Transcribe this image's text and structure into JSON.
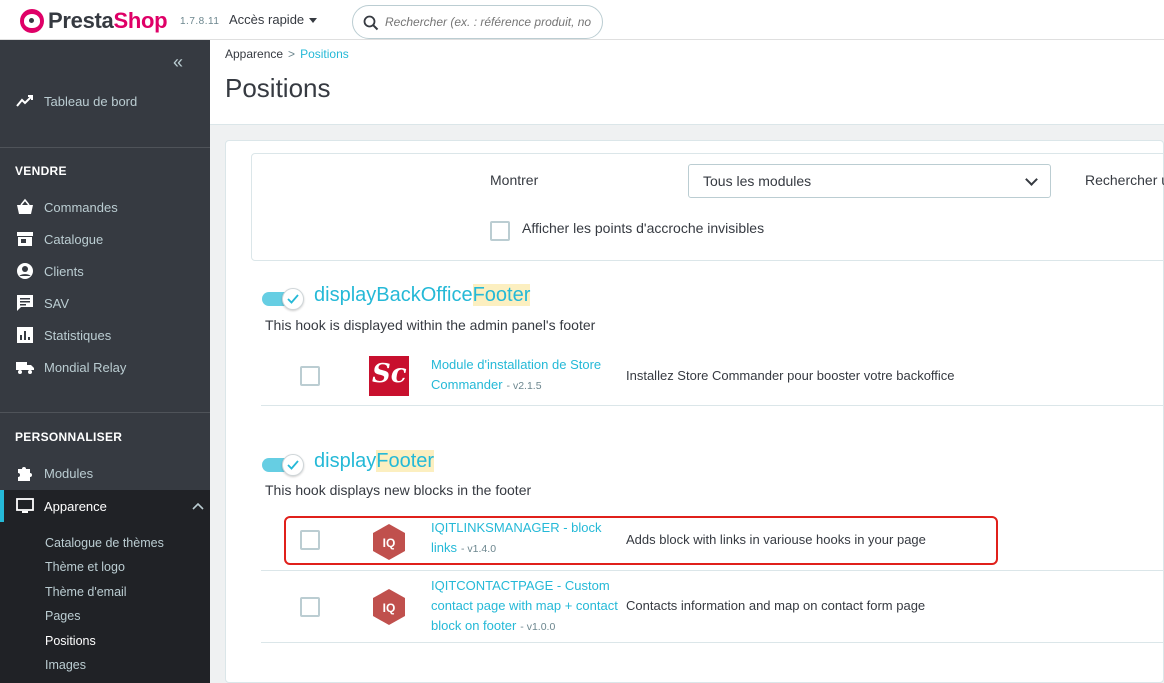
{
  "header": {
    "logo_prefix": "Presta",
    "logo_suffix": "Shop",
    "version": "1.7.8.11",
    "quick_access": "Accès rapide",
    "search_placeholder": "Rechercher (ex. : référence produit, no"
  },
  "sidebar": {
    "dashboard": "Tableau de bord",
    "section_sell": "VENDRE",
    "sell_items": [
      "Commandes",
      "Catalogue",
      "Clients",
      "SAV",
      "Statistiques",
      "Mondial Relay"
    ],
    "section_customize": "PERSONNALISER",
    "modules": "Modules",
    "appearance": "Apparence",
    "appearance_sub": [
      "Catalogue de thèmes",
      "Thème et logo",
      "Thème d'email",
      "Pages",
      "Positions",
      "Images"
    ]
  },
  "breadcrumb": {
    "parent": "Apparence",
    "separator": ">",
    "current": "Positions"
  },
  "page_title": "Positions",
  "filters": {
    "show_label": "Montrer",
    "show_value": "Tous les modules",
    "search_label": "Rechercher u",
    "invisible_hooks_label": "Afficher les points d'accroche invisibles"
  },
  "hooks": [
    {
      "name_prefix": "displayBackOffice",
      "name_highlight": "Footer",
      "description": "This hook is displayed within the admin panel's footer",
      "modules": [
        {
          "logo": "Sc",
          "name": "Module d'installation de Store Commander",
          "version": "- v2.1.5",
          "description": "Installez Store Commander pour booster votre backoffice"
        }
      ]
    },
    {
      "name_prefix": "display",
      "name_highlight": "Footer",
      "description": "This hook displays new blocks in the footer",
      "modules": [
        {
          "logo": "IQ",
          "name": "IQITLINKSMANAGER - block links",
          "version": "- v1.4.0",
          "description": "Adds block with links in variouse hooks in your page"
        },
        {
          "logo": "IQ",
          "name": "IQITCONTACTPAGE - Custom contact page with map + contact block on footer",
          "version": "- v1.0.0",
          "description": "Contacts information and map on contact form page"
        }
      ]
    }
  ],
  "colors": {
    "accent": "#25b9d7",
    "sidebar": "#363a41",
    "brand": "#df0067",
    "annotation": "#e0201b"
  }
}
